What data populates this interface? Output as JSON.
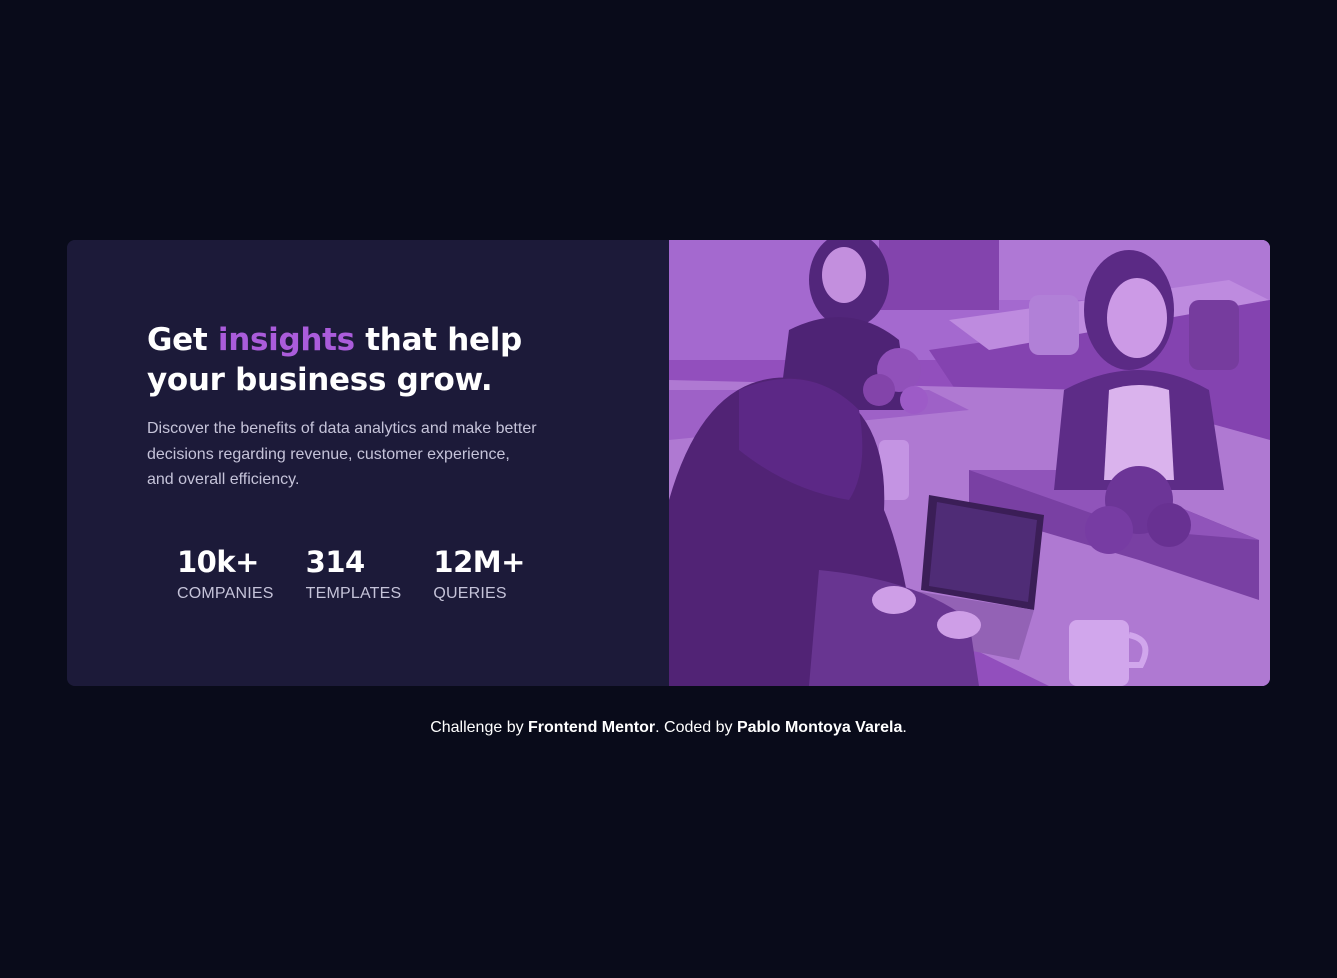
{
  "card": {
    "headline": {
      "before": "Get ",
      "accent": "insights",
      "after": " that help your business grow."
    },
    "description": "Discover the benefits of data analytics and make better decisions regarding revenue, customer experience, and overall efficiency.",
    "stats": [
      {
        "value": "10k+",
        "label": "COMPANIES"
      },
      {
        "value": "314",
        "label": "TEMPLATES"
      },
      {
        "value": "12M+",
        "label": "QUERIES"
      }
    ],
    "image_overlay_color": "#aa5cdb"
  },
  "footer": {
    "prefix": "Challenge by ",
    "challenge_link": "Frontend Mentor",
    "middle": ". Coded by ",
    "author_link": "Pablo Montoya Varela",
    "suffix": "."
  },
  "colors": {
    "page_background": "#090b1a",
    "card_background": "#1c1a39",
    "accent": "#aa5cdb",
    "main_heading": "#ffffff",
    "main_paragraph": "#c5c3d9"
  }
}
